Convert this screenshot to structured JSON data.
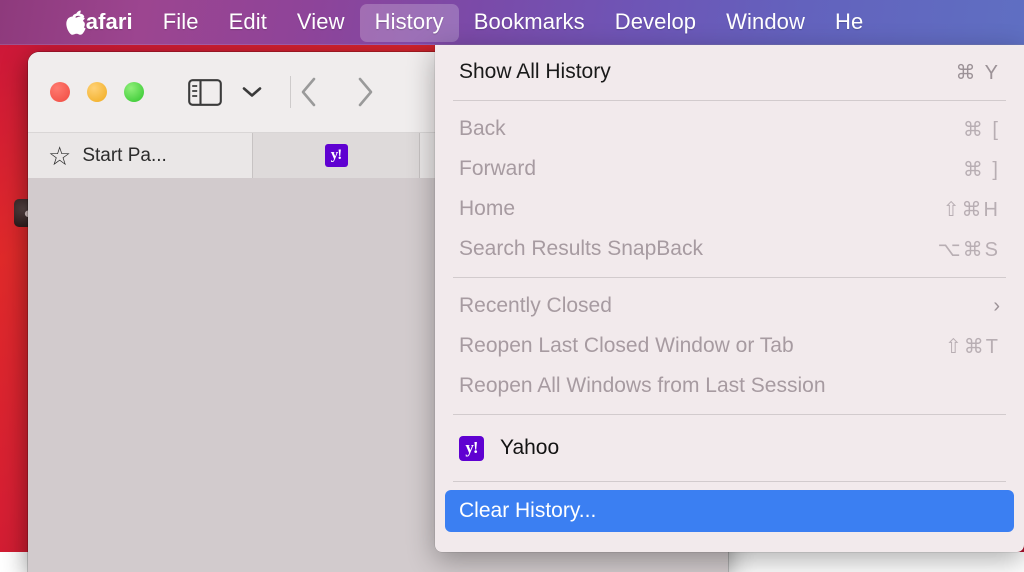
{
  "menubar": {
    "apple_icon": "apple-logo",
    "items": [
      {
        "label": "Safari",
        "bold": true,
        "active": false
      },
      {
        "label": "File",
        "bold": false,
        "active": false
      },
      {
        "label": "Edit",
        "bold": false,
        "active": false
      },
      {
        "label": "View",
        "bold": false,
        "active": false
      },
      {
        "label": "History",
        "bold": false,
        "active": true
      },
      {
        "label": "Bookmarks",
        "bold": false,
        "active": false
      },
      {
        "label": "Develop",
        "bold": false,
        "active": false
      },
      {
        "label": "Window",
        "bold": false,
        "active": false
      },
      {
        "label": "He",
        "bold": false,
        "active": false
      }
    ]
  },
  "window": {
    "traffic_lights": {
      "close": "close-button",
      "minimize": "minimize-button",
      "maximize": "maximize-button"
    },
    "toolbar": {
      "sidebar_icon": "sidebar-toggle-icon",
      "chevron_icon": "chevron-down-icon",
      "back_icon": "back-arrow-icon",
      "forward_icon": "forward-arrow-icon"
    },
    "tabs": [
      {
        "star": "☆",
        "label": "Start Pa...",
        "favicon": "",
        "active": false
      },
      {
        "star": "",
        "label": "",
        "favicon": "y!",
        "active": true
      },
      {
        "star": "",
        "label": "",
        "favicon": "",
        "active": false
      }
    ]
  },
  "history_menu": {
    "groups": [
      {
        "items": [
          {
            "label": "Show All History",
            "shortcut": "⌘ Y",
            "enabled": true,
            "submenu": false,
            "favicon": ""
          }
        ]
      },
      {
        "items": [
          {
            "label": "Back",
            "shortcut": "⌘ [",
            "enabled": false,
            "submenu": false,
            "favicon": ""
          },
          {
            "label": "Forward",
            "shortcut": "⌘ ]",
            "enabled": false,
            "submenu": false,
            "favicon": ""
          },
          {
            "label": "Home",
            "shortcut": "⇧⌘H",
            "enabled": false,
            "submenu": false,
            "favicon": ""
          },
          {
            "label": "Search Results SnapBack",
            "shortcut": "⌥⌘S",
            "enabled": false,
            "submenu": false,
            "favicon": ""
          }
        ]
      },
      {
        "items": [
          {
            "label": "Recently Closed",
            "shortcut": "",
            "enabled": false,
            "submenu": true,
            "favicon": ""
          },
          {
            "label": "Reopen Last Closed Window or Tab",
            "shortcut": "⇧⌘T",
            "enabled": false,
            "submenu": false,
            "favicon": ""
          },
          {
            "label": "Reopen All Windows from Last Session",
            "shortcut": "",
            "enabled": false,
            "submenu": false,
            "favicon": ""
          }
        ]
      },
      {
        "items": [
          {
            "label": "Yahoo",
            "shortcut": "",
            "enabled": true,
            "submenu": false,
            "favicon": "y!"
          }
        ]
      },
      {
        "items": [
          {
            "label": "Clear History...",
            "shortcut": "",
            "enabled": true,
            "submenu": false,
            "favicon": "",
            "highlighted": true
          }
        ]
      }
    ],
    "submenu_arrow_glyph": "›",
    "highlight_color": "#3b7ff2"
  },
  "desktop": {
    "icon_glyph": "●",
    "wallpaper_color": "#d61f33"
  }
}
